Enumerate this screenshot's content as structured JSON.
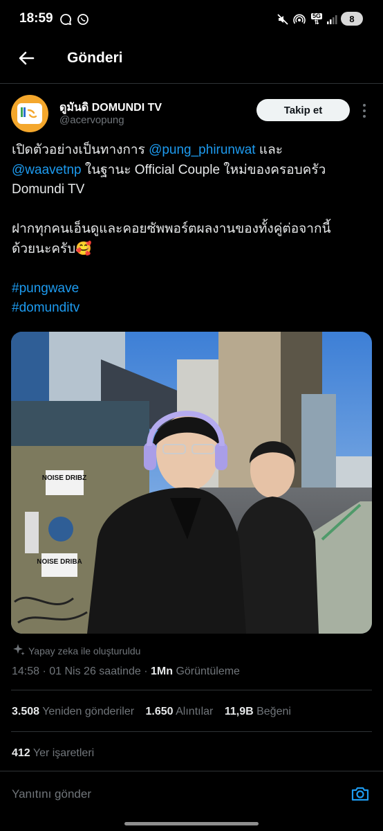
{
  "status_bar": {
    "time": "18:59",
    "network": "5G",
    "battery": "8"
  },
  "header": {
    "title": "Gönderi"
  },
  "author": {
    "name": "ดูมันดิ DOMUNDI TV",
    "handle": "@acervopung",
    "follow_label": "Takip et"
  },
  "post": {
    "line1_pre": "เปิดตัวอย่างเป็นทางการ ",
    "mention1": "@pung_phirunwat",
    "line1_post": "  และ",
    "mention2": "@waavetnp",
    "line2_post": " ในฐานะ Official Couple ใหม่ของครอบครัว",
    "line3": "Domundi TV",
    "line4": "ฝากทุกคนเอ็นดูและคอยซัพพอร์ตผลงานของทั้งคู่ต่อจากนี้",
    "line5": "ด้วยนะครับ🥰",
    "hashtag1": "#pungwave",
    "hashtag2": "#domunditv"
  },
  "media": {
    "stickers": [
      "NOISE DRIBZ",
      "NOISE DRIBA"
    ]
  },
  "ai_label": "Yapay zeka ile oluşturuldu",
  "meta": {
    "time_date": "14:58 · 01 Nis 26 saatinde · ",
    "views_value": "1Mn",
    "views_label": " Görüntüleme"
  },
  "stats": {
    "reposts_value": "3.508",
    "reposts_label": "Yeniden gönderiler",
    "quotes_value": "1.650",
    "quotes_label": "Alıntılar",
    "likes_value": "11,9B",
    "likes_label": "Beğeni"
  },
  "bookmarks": {
    "value": "412",
    "label": "Yer işaretleri"
  },
  "reply": {
    "placeholder": "Yanıtını gönder"
  },
  "colors": {
    "accent": "#1d9bf0",
    "background": "#000000",
    "muted": "#71767b"
  }
}
